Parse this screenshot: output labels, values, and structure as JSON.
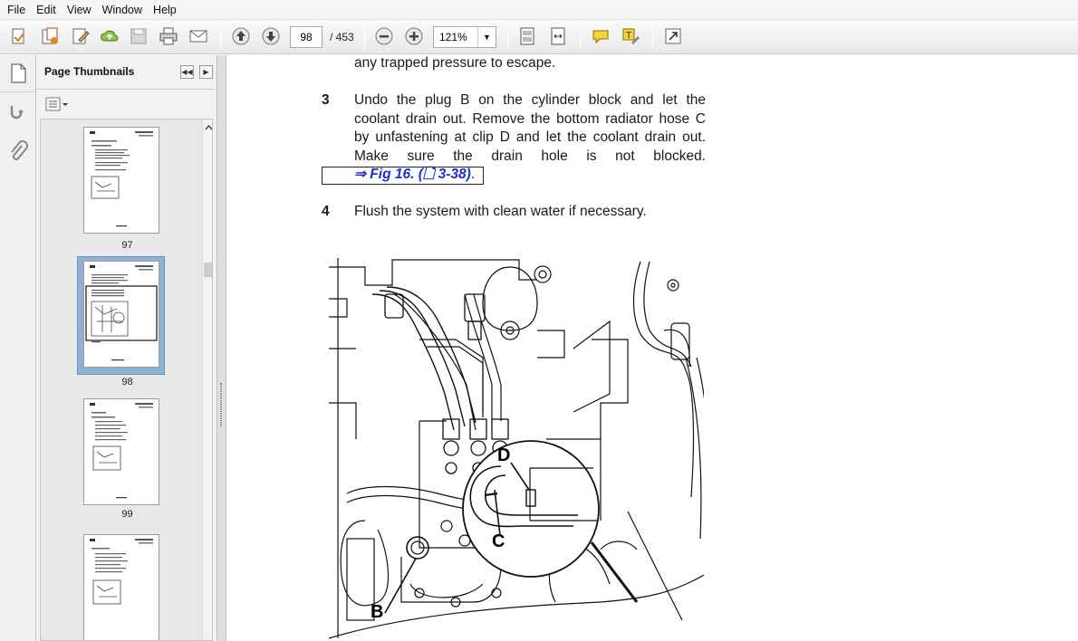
{
  "menu": [
    "File",
    "Edit",
    "View",
    "Window",
    "Help"
  ],
  "toolbar": {
    "page_current": "98",
    "page_total": "/ 453",
    "zoom": "121%"
  },
  "sidebar": {
    "title": "Page Thumbnails",
    "thumbnails": [
      {
        "label": "97"
      },
      {
        "label": "98"
      },
      {
        "label": "99"
      }
    ]
  },
  "document": {
    "prev_line": "any trapped pressure to escape.",
    "steps": [
      {
        "num": "3",
        "lines": [
          "Undo the plug B on the cylinder block and let the",
          "coolant drain out. Remove the bottom radiator hose C",
          "by unfastening at clip D and let the coolant drain out.",
          "Make sure the drain hole is not blocked."
        ],
        "link": "⇒ Fig 16. (🗋 3-38)",
        "link_after": "."
      },
      {
        "num": "4",
        "lines": [
          "Flush the system with clean water if necessary."
        ]
      }
    ],
    "figure_labels": {
      "b": "B",
      "c": "C",
      "d": "D"
    }
  }
}
